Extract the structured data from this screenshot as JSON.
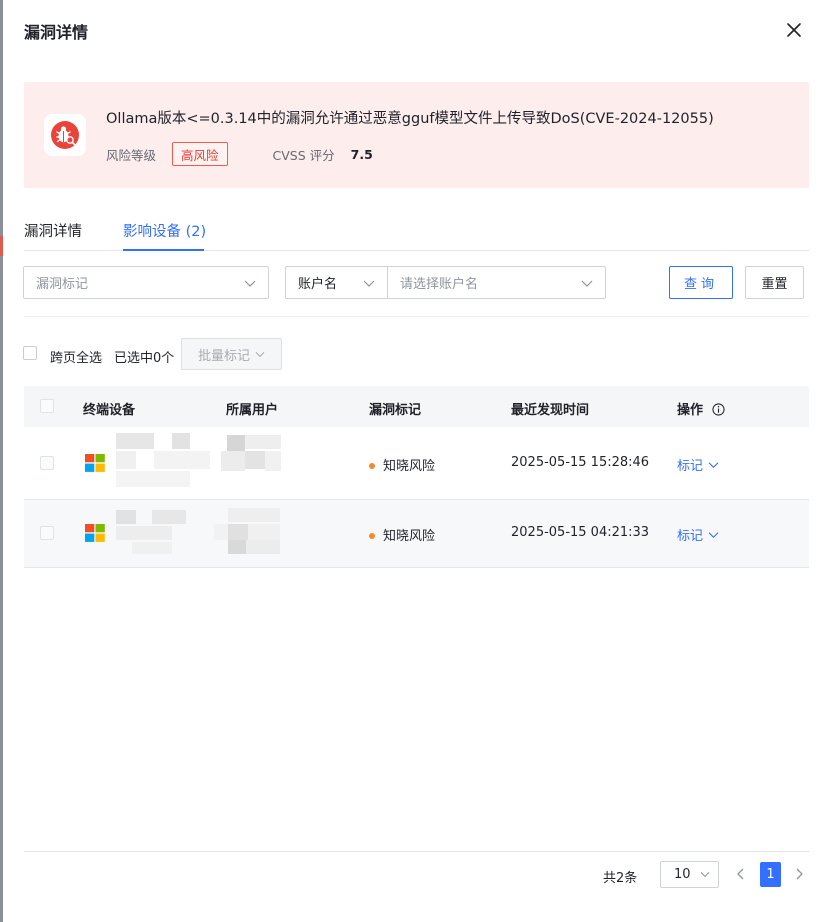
{
  "dialog": {
    "title": "漏洞详情"
  },
  "vuln": {
    "title": "Ollama版本<=0.3.14中的漏洞允许通过恶意gguf模型文件上传导致DoS(CVE-2024-12055)",
    "risk_label": "风险等级",
    "risk_value": "高风险",
    "cvss_label": "CVSS 评分",
    "cvss_value": "7.5"
  },
  "tabs": [
    {
      "label": "漏洞详情"
    },
    {
      "label": "影响设备 (2)"
    }
  ],
  "filters": {
    "mark_placeholder": "漏洞标记",
    "account_type": "账户名",
    "account_placeholder": "请选择账户名",
    "query_label": "查询",
    "reset_label": "重置"
  },
  "selection": {
    "cross_page_label": "跨页全选",
    "selected_text": "已选中0个",
    "batch_label": "批量标记"
  },
  "table": {
    "columns": [
      "终端设备",
      "所属用户",
      "漏洞标记",
      "最近发现时间",
      "操作"
    ],
    "rows": [
      {
        "device_icon": "windows-icon",
        "mark": "知晓风险",
        "time": "2025-05-15 15:28:46",
        "action": "标记"
      },
      {
        "device_icon": "windows-icon",
        "mark": "知晓风险",
        "time": "2025-05-15 04:21:33",
        "action": "标记"
      }
    ]
  },
  "pagination": {
    "total_text": "共2条",
    "page_size": "10",
    "current_page": "1"
  },
  "colors": {
    "accent": "#3370ff",
    "danger": "#e43d33",
    "banner_bg": "#fdeded",
    "mark_dot": "#f58a2b"
  },
  "icons": {
    "close": "close-icon",
    "bug": "bug-icon",
    "chevron": "chevron-down-icon",
    "info": "info-icon",
    "prev": "chevron-left-icon",
    "next": "chevron-right-icon"
  }
}
